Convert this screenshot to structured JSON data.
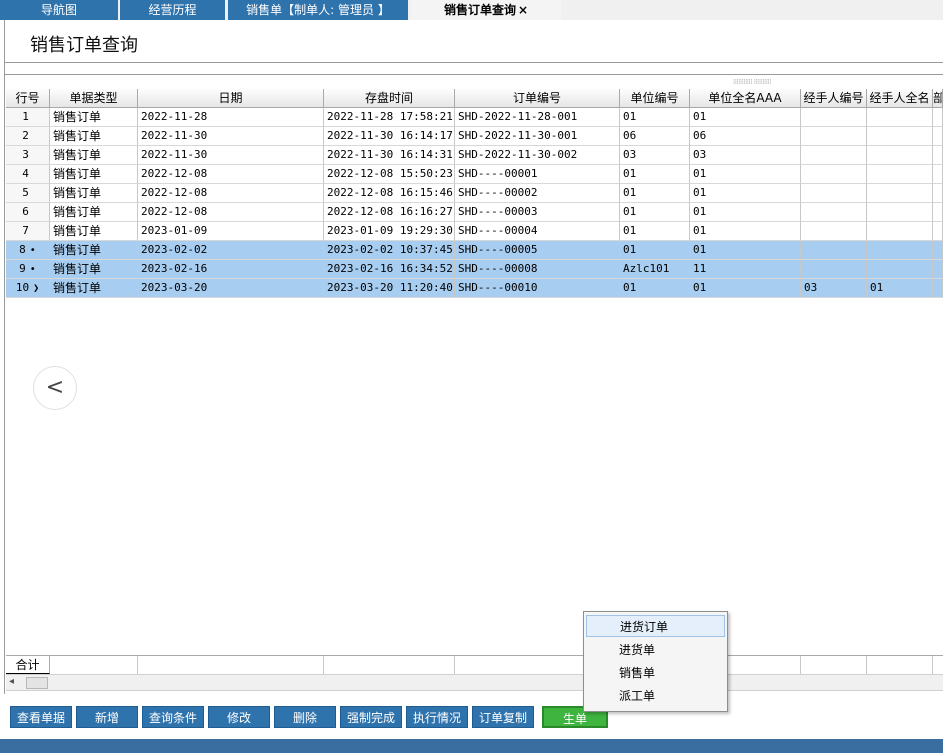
{
  "tabs": [
    {
      "label": "导航图"
    },
    {
      "label": "经营历程"
    },
    {
      "label": "销售单【制单人: 管理员 】"
    },
    {
      "label": "销售订单查询",
      "close": "×"
    }
  ],
  "page_title": "销售订单查询",
  "grid": {
    "headers": [
      "行号",
      "单据类型",
      "日期",
      "存盘时间",
      "订单编号",
      "单位编号",
      "单位全名AAA",
      "经手人编号",
      "经手人全名",
      "部"
    ],
    "rows": [
      {
        "n": "1",
        "mark": "",
        "type": "销售订单",
        "date": "2022-11-28",
        "saved": "2022-11-28 17:58:21",
        "order": "SHD-2022-11-28-001",
        "unit_no": "01",
        "unit_name": "01",
        "h_no": "",
        "h_name": ""
      },
      {
        "n": "2",
        "mark": "",
        "type": "销售订单",
        "date": "2022-11-30",
        "saved": "2022-11-30 16:14:17",
        "order": "SHD-2022-11-30-001",
        "unit_no": "06",
        "unit_name": "06",
        "h_no": "",
        "h_name": ""
      },
      {
        "n": "3",
        "mark": "",
        "type": "销售订单",
        "date": "2022-11-30",
        "saved": "2022-11-30 16:14:31",
        "order": "SHD-2022-11-30-002",
        "unit_no": "03",
        "unit_name": "03",
        "h_no": "",
        "h_name": ""
      },
      {
        "n": "4",
        "mark": "",
        "type": "销售订单",
        "date": "2022-12-08",
        "saved": "2022-12-08 15:50:23",
        "order": "SHD----00001",
        "unit_no": "01",
        "unit_name": "01",
        "h_no": "",
        "h_name": ""
      },
      {
        "n": "5",
        "mark": "",
        "type": "销售订单",
        "date": "2022-12-08",
        "saved": "2022-12-08 16:15:46",
        "order": "SHD----00002",
        "unit_no": "01",
        "unit_name": "01",
        "h_no": "",
        "h_name": ""
      },
      {
        "n": "6",
        "mark": "",
        "type": "销售订单",
        "date": "2022-12-08",
        "saved": "2022-12-08 16:16:27",
        "order": "SHD----00003",
        "unit_no": "01",
        "unit_name": "01",
        "h_no": "",
        "h_name": ""
      },
      {
        "n": "7",
        "mark": "",
        "type": "销售订单",
        "date": "2023-01-09",
        "saved": "2023-01-09 19:29:30",
        "order": "SHD----00004",
        "unit_no": "01",
        "unit_name": "01",
        "h_no": "",
        "h_name": ""
      },
      {
        "n": "8",
        "mark": "•",
        "type": "销售订单",
        "date": "2023-02-02",
        "saved": "2023-02-02 10:37:45",
        "order": "SHD----00005",
        "unit_no": "01",
        "unit_name": "01",
        "h_no": "",
        "h_name": ""
      },
      {
        "n": "9",
        "mark": "•",
        "type": "销售订单",
        "date": "2023-02-16",
        "saved": "2023-02-16 16:34:52",
        "order": "SHD----00008",
        "unit_no": "Azlc101",
        "unit_name": "11",
        "h_no": "",
        "h_name": ""
      },
      {
        "n": "10",
        "mark": "❯",
        "type": "销售订单",
        "date": "2023-03-20",
        "saved": "2023-03-20 11:20:40",
        "order": "SHD----00010",
        "unit_no": "01",
        "unit_name": "01",
        "h_no": "03",
        "h_name": "01"
      }
    ],
    "selected_rows": [
      "8",
      "9",
      "10"
    ],
    "total_label": "合计"
  },
  "toolbar": {
    "buttons": [
      "查看单据",
      "新增",
      "查询条件",
      "修改",
      "删除",
      "强制完成",
      "执行情况",
      "订单复制",
      "生单"
    ]
  },
  "context_menu": {
    "items": [
      "进货订单",
      "进货单",
      "销售单",
      "派工单"
    ],
    "highlighted": "进货订单"
  },
  "icons": {
    "nav_left": "chevron-left-icon"
  },
  "colors": {
    "accent": "#2f73ad",
    "selection": "#a7cdf0",
    "green_button": "#3fb43f"
  }
}
